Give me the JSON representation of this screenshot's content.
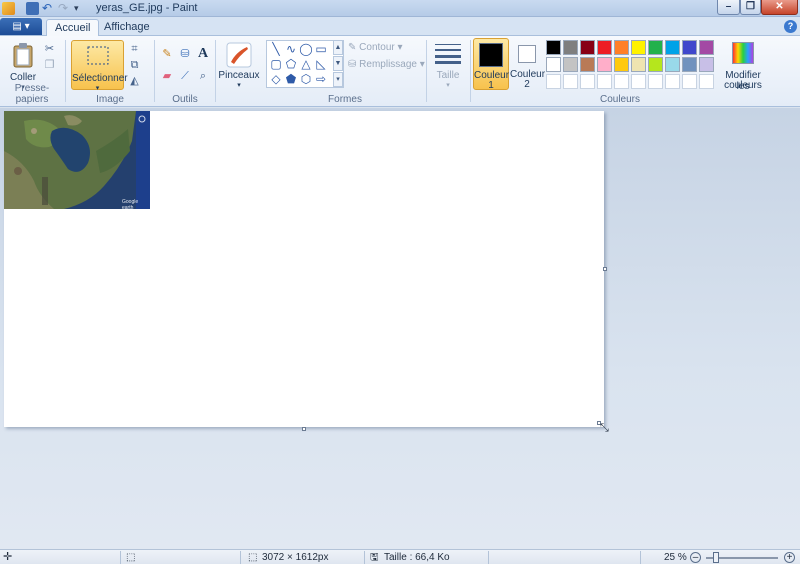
{
  "window": {
    "title": "yeras_GE.jpg - Paint",
    "minimize": "–",
    "maximize": "❐",
    "close": "✕"
  },
  "tabs": {
    "file_menu": "▤ ▾",
    "home": "Accueil",
    "view": "Affichage",
    "help": "?"
  },
  "ribbon": {
    "clipboard": {
      "paste": "Coller",
      "group": "Presse-papiers"
    },
    "image": {
      "select": "Sélectionner",
      "group": "Image"
    },
    "tools": {
      "group": "Outils"
    },
    "brushes": {
      "label": "Pinceaux"
    },
    "shapes": {
      "outline": "Contour",
      "fill": "Remplissage",
      "group": "Formes"
    },
    "size": {
      "label": "Taille"
    },
    "colors": {
      "color1_line1": "Couleur",
      "color1_line2": "1",
      "color2_line1": "Couleur",
      "color2_line2": "2",
      "edit_line1": "Modifier les",
      "edit_line2": "couleurs",
      "group": "Couleurs",
      "color1_value": "#000000",
      "color2_value": "#ffffff",
      "palette_row1": [
        "#000000",
        "#7f7f7f",
        "#880015",
        "#ed1c24",
        "#ff7f27",
        "#fff200",
        "#22b14c",
        "#00a2e8",
        "#3f48cc",
        "#a349a4"
      ],
      "palette_row2": [
        "#ffffff",
        "#c3c3c3",
        "#b97a57",
        "#ffaec9",
        "#ffc90e",
        "#efe4b0",
        "#b5e61d",
        "#99d9ea",
        "#7092be",
        "#c8bfe7"
      ]
    }
  },
  "status": {
    "dimensions": "3072 × 1612px",
    "size": "Taille : 66,4 Ko",
    "zoom": "25 %"
  },
  "image_overlay": {
    "watermark": "Google earth"
  }
}
